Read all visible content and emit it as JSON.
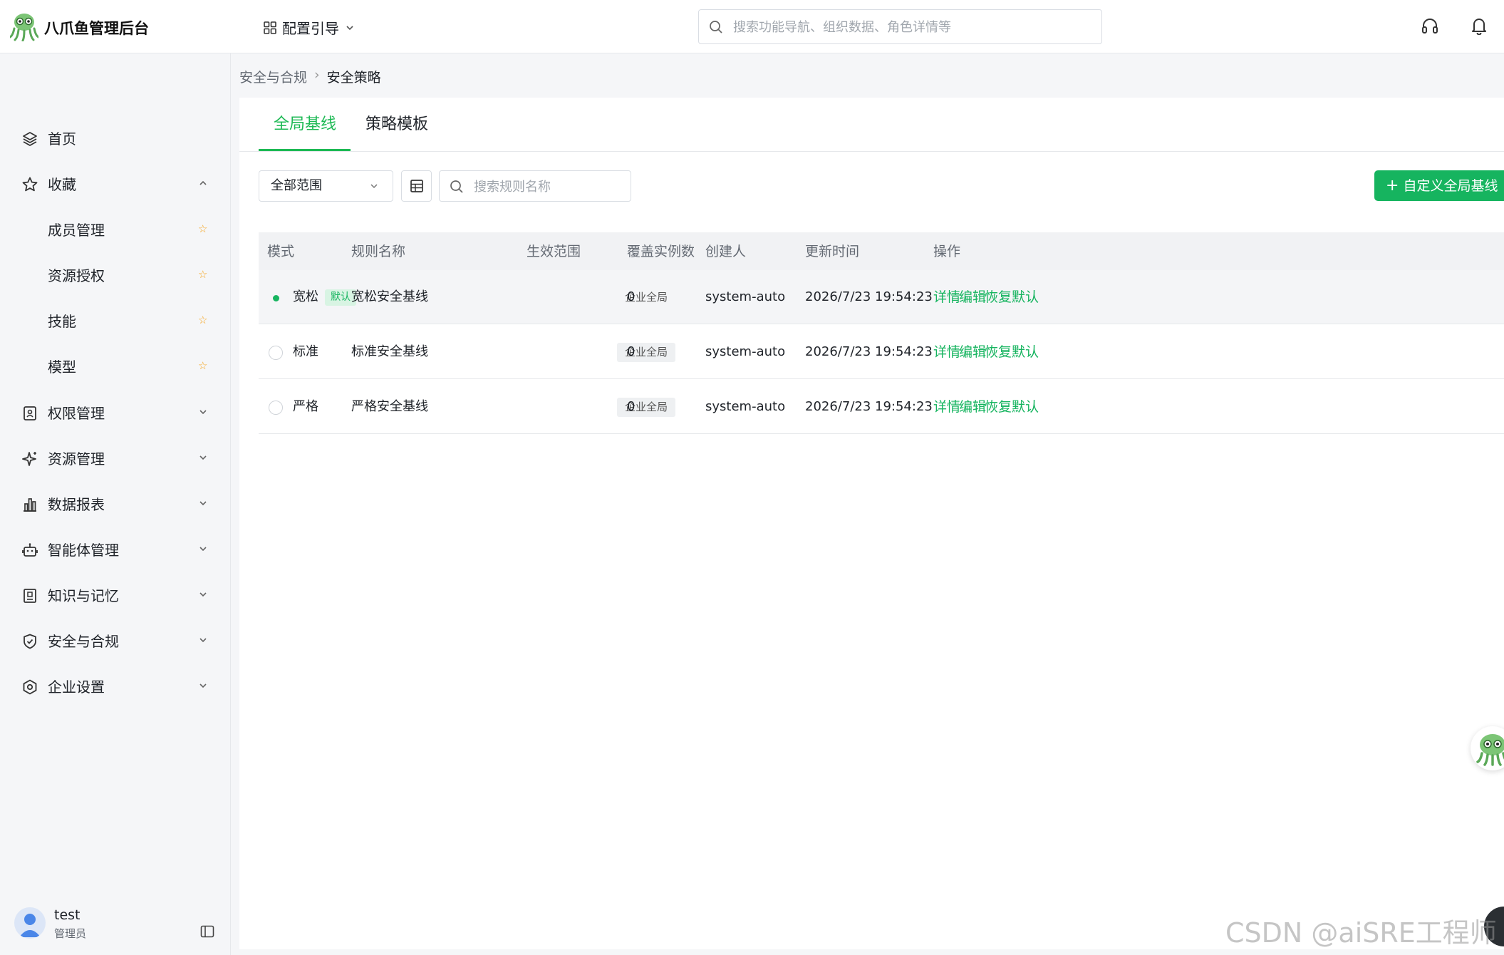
{
  "app": {
    "title": "八爪鱼管理后台"
  },
  "header": {
    "guide_label": "配置引导",
    "search_placeholder": "搜索功能导航、组织数据、角色详情等"
  },
  "sidebar": {
    "items": [
      {
        "label": "首页",
        "icon": "layers-icon"
      },
      {
        "label": "收藏",
        "icon": "star-icon",
        "expanded": true,
        "children": [
          {
            "label": "成员管理"
          },
          {
            "label": "资源授权"
          },
          {
            "label": "技能"
          },
          {
            "label": "模型"
          }
        ]
      },
      {
        "label": "权限管理",
        "icon": "badge-icon"
      },
      {
        "label": "资源管理",
        "icon": "sparkle-icon"
      },
      {
        "label": "数据报表",
        "icon": "bar-chart-icon"
      },
      {
        "label": "智能体管理",
        "icon": "robot-icon"
      },
      {
        "label": "知识与记忆",
        "icon": "book-icon"
      },
      {
        "label": "安全与合规",
        "icon": "shield-icon"
      },
      {
        "label": "企业设置",
        "icon": "settings-icon"
      }
    ],
    "user": {
      "name": "test",
      "role": "管理员"
    }
  },
  "breadcrumb": {
    "parent": "安全与合规",
    "separator": "›",
    "current": "安全策略"
  },
  "tabs": [
    {
      "label": "全局基线",
      "active": true
    },
    {
      "label": "策略模板",
      "active": false
    }
  ],
  "toolbar": {
    "scope_select": "全部范围",
    "search_placeholder": "搜索规则名称",
    "add_button": "自定义全局基线"
  },
  "table": {
    "columns": [
      "模式",
      "规则名称",
      "生效范围",
      "覆盖实例数",
      "创建人",
      "更新时间",
      "操作"
    ],
    "rows": [
      {
        "mode": "宽松",
        "is_default": true,
        "default_label": "默认",
        "name": "宽松安全基线",
        "scope": "企业全局",
        "instances": "0",
        "creator": "system-auto",
        "updated": "2026/7/23 19:54:23",
        "selected": true
      },
      {
        "mode": "标准",
        "is_default": false,
        "name": "标准安全基线",
        "scope": "企业全局",
        "instances": "0",
        "creator": "system-auto",
        "updated": "2026/7/23 19:54:23",
        "selected": false
      },
      {
        "mode": "严格",
        "is_default": false,
        "name": "严格安全基线",
        "scope": "企业全局",
        "instances": "0",
        "creator": "system-auto",
        "updated": "2026/7/23 19:54:23",
        "selected": false
      }
    ],
    "actions": [
      "详情",
      "编辑",
      "恢复默认"
    ]
  },
  "watermark": "CSDN @aiSRE工程师",
  "colors": {
    "accent": "#16b45f",
    "sidebar_bg": "#f5f6f8",
    "star": "#f5a623"
  }
}
